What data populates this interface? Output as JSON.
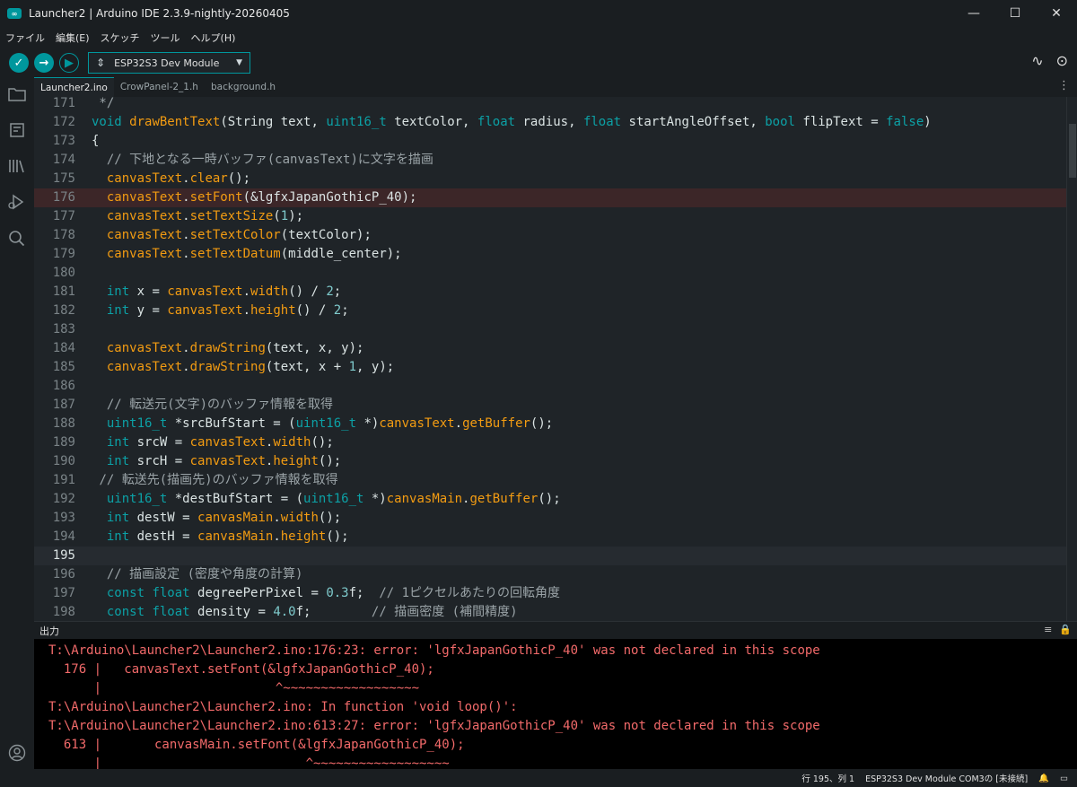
{
  "window": {
    "title": "Launcher2 | Arduino IDE 2.3.9-nightly-20260405",
    "app_icon_text": "∞",
    "controls": [
      "—",
      "☐",
      "✕"
    ]
  },
  "menu": [
    "ファイル",
    "編集(E)",
    "スケッチ",
    "ツール",
    "ヘルプ(H)"
  ],
  "toolbar": {
    "verify_icon": "✓",
    "upload_icon": "→",
    "debug_icon": "▶",
    "board_usb_icon": "⇕",
    "board_name": "ESP32S3 Dev Module",
    "board_caret": "▼",
    "serial_plotter_icon": "∿",
    "serial_monitor_icon": "⊙"
  },
  "activity_icons": [
    "folder-icon",
    "board-icon",
    "library-icon",
    "debug-icon",
    "search-icon",
    "account-icon"
  ],
  "tabs": [
    "Launcher2.ino",
    "CrowPanel-2_1.h",
    "background.h"
  ],
  "tabs_more": "⋮",
  "editor": {
    "lines": [
      {
        "n": "171",
        "html": " */",
        "cls": "cm"
      },
      {
        "n": "172",
        "html": "<span class=\"kw\">void</span> <span class=\"fn\">drawBentText</span>(String text, <span class=\"kw\">uint16_t</span> textColor, <span class=\"kw\">float</span> radius, <span class=\"kw\">float</span> startAngleOffset, <span class=\"kw\">bool</span> flipText = <span class=\"kw\">false</span>)"
      },
      {
        "n": "173",
        "html": "{"
      },
      {
        "n": "174",
        "html": "  <span class=\"cm\">// 下地となる一時バッファ(canvasText)に文字を描画</span>"
      },
      {
        "n": "175",
        "html": "  <span class=\"fn\">canvasText</span>.<span class=\"fn\">clear</span>();"
      },
      {
        "n": "176",
        "html": "  <span class=\"fn\">canvasText</span>.<span class=\"fn\">setFont</span>(&amp;lgfxJapanGothicP_40);",
        "err": true
      },
      {
        "n": "177",
        "html": "  <span class=\"fn\">canvasText</span>.<span class=\"fn\">setTextSize</span>(<span class=\"nm\">1</span>);"
      },
      {
        "n": "178",
        "html": "  <span class=\"fn\">canvasText</span>.<span class=\"fn\">setTextColor</span>(textColor);"
      },
      {
        "n": "179",
        "html": "  <span class=\"fn\">canvasText</span>.<span class=\"fn\">setTextDatum</span>(middle_center);"
      },
      {
        "n": "180",
        "html": ""
      },
      {
        "n": "181",
        "html": "  <span class=\"kw\">int</span> x = <span class=\"fn\">canvasText</span>.<span class=\"fn\">width</span>() / <span class=\"nm\">2</span>;"
      },
      {
        "n": "182",
        "html": "  <span class=\"kw\">int</span> y = <span class=\"fn\">canvasText</span>.<span class=\"fn\">height</span>() / <span class=\"nm\">2</span>;"
      },
      {
        "n": "183",
        "html": ""
      },
      {
        "n": "184",
        "html": "  <span class=\"fn\">canvasText</span>.<span class=\"fn\">drawString</span>(text, x, y);"
      },
      {
        "n": "185",
        "html": "  <span class=\"fn\">canvasText</span>.<span class=\"fn\">drawString</span>(text, x + <span class=\"nm\">1</span>, y);"
      },
      {
        "n": "186",
        "html": ""
      },
      {
        "n": "187",
        "html": "  <span class=\"cm\">// 転送元(文字)のバッファ情報を取得</span>"
      },
      {
        "n": "188",
        "html": "  <span class=\"kw\">uint16_t</span> *srcBufStart = (<span class=\"kw\">uint16_t</span> *)<span class=\"fn\">canvasText</span>.<span class=\"fn\">getBuffer</span>();"
      },
      {
        "n": "189",
        "html": "  <span class=\"kw\">int</span> srcW = <span class=\"fn\">canvasText</span>.<span class=\"fn\">width</span>();"
      },
      {
        "n": "190",
        "html": "  <span class=\"kw\">int</span> srcH = <span class=\"fn\">canvasText</span>.<span class=\"fn\">height</span>();"
      },
      {
        "n": "191",
        "html": " <span class=\"cm\">// 転送先(描画先)のバッファ情報を取得</span>"
      },
      {
        "n": "192",
        "html": "  <span class=\"kw\">uint16_t</span> *destBufStart = (<span class=\"kw\">uint16_t</span> *)<span class=\"fn\">canvasMain</span>.<span class=\"fn\">getBuffer</span>();"
      },
      {
        "n": "193",
        "html": "  <span class=\"kw\">int</span> destW = <span class=\"fn\">canvasMain</span>.<span class=\"fn\">width</span>();"
      },
      {
        "n": "194",
        "html": "  <span class=\"kw\">int</span> destH = <span class=\"fn\">canvasMain</span>.<span class=\"fn\">height</span>();"
      },
      {
        "n": "195",
        "html": "",
        "cur": true
      },
      {
        "n": "196",
        "html": "  <span class=\"cm\">// 描画設定 (密度や角度の計算)</span>"
      },
      {
        "n": "197",
        "html": "  <span class=\"kw\">const</span> <span class=\"kw\">float</span> degreePerPixel = <span class=\"nm\">0.3</span>f;  <span class=\"cm\">// 1ピクセルあたりの回転角度</span>"
      },
      {
        "n": "198",
        "html": "  <span class=\"kw\">const</span> <span class=\"kw\">float</span> density = <span class=\"nm\">4.0</span>f;        <span class=\"cm\">// 描画密度 (補間精度)</span>"
      }
    ]
  },
  "output": {
    "title": "出力",
    "actions": [
      "≡",
      "🔒"
    ],
    "lines": [
      "T:\\Arduino\\Launcher2\\Launcher2.ino:176:23: error: 'lgfxJapanGothicP_40' was not declared in this scope",
      "  176 |   canvasText.setFont(&lgfxJapanGothicP_40);",
      "      |                       ^~~~~~~~~~~~~~~~~~~",
      "T:\\Arduino\\Launcher2\\Launcher2.ino: In function 'void loop()':",
      "T:\\Arduino\\Launcher2\\Launcher2.ino:613:27: error: 'lgfxJapanGothicP_40' was not declared in this scope",
      "  613 |       canvasMain.setFont(&lgfxJapanGothicP_40);",
      "      |                           ^~~~~~~~~~~~~~~~~~~"
    ]
  },
  "status": {
    "position": "行 195、列 1",
    "board_port": "ESP32S3 Dev Module COM3の [未接続]",
    "notification_icon": "🔔",
    "panel_icon": "▭"
  }
}
